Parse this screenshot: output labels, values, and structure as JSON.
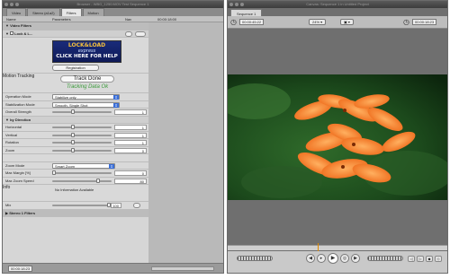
{
  "browser": {
    "title": "Browser - WBG_1250.MOV Test Sequence 1",
    "tabs": [
      "Video",
      "Stereo (a1a2)",
      "Filters",
      "Motion"
    ],
    "active_tab": "Filters",
    "columns": {
      "name": "Name",
      "parameters": "Parameters",
      "nav": "Nav",
      "timecode": "00:00:18:00"
    },
    "groups": {
      "video_filters": "Video Filters",
      "filter_name": "Lock & L...",
      "stereo_filters": "Stereo 1 Filters"
    },
    "ad": {
      "line1": "LOCK&LOAD",
      "line2": "express",
      "line3": "CLICK HERE FOR HELP",
      "registration": "Registration"
    },
    "motion_tracking": {
      "label": "Motion Tracking",
      "button": "Track Done",
      "status": "Tracking Data Ok"
    },
    "operation_mode": {
      "label": "Operation Mode",
      "value": "Stabilize only"
    },
    "stabilization_mode": {
      "label": "Stabilization Mode",
      "value": "Smooth, Single Shot"
    },
    "overall_strength": {
      "label": "Overall Strength",
      "value": "1",
      "fraction": 0.35
    },
    "by_direction": {
      "label": "by Direction"
    },
    "horizontal": {
      "label": "Horizontal",
      "value": "1",
      "fraction": 0.35
    },
    "vertical": {
      "label": "Vertical",
      "value": "1",
      "fraction": 0.35
    },
    "rotation": {
      "label": "Rotation",
      "value": "1",
      "fraction": 0.35
    },
    "zoom": {
      "label": "Zoom",
      "value": "0",
      "fraction": 0.35
    },
    "zoom_mode": {
      "label": "Zoom Mode",
      "value": "Smart Zoom"
    },
    "max_margin": {
      "label": "Max Margin [%]",
      "value": "0",
      "fraction": 0.0
    },
    "max_zoom_speed": {
      "label": "Max Zoom Speed",
      "value": "80",
      "fraction": 0.8
    },
    "info": {
      "label": "Info",
      "value": "No Information Available"
    },
    "mix": {
      "label": "Mix",
      "value": "100",
      "fraction": 1.0
    },
    "timecode_bottom": "00:00:18:23"
  },
  "viewer": {
    "title": "Canvas: Sequence 1 in Untitled Project",
    "tab": "Sequence 1",
    "timecode_left": "00:00:45:22",
    "zoom": "24%",
    "timecode_right": "00:00:18:23"
  },
  "colors": {
    "window_bg": "#d6d6d6",
    "accent_blue": "#3b6fd8",
    "tracking_green": "#3a9a3a",
    "playhead": "#e08a00"
  }
}
